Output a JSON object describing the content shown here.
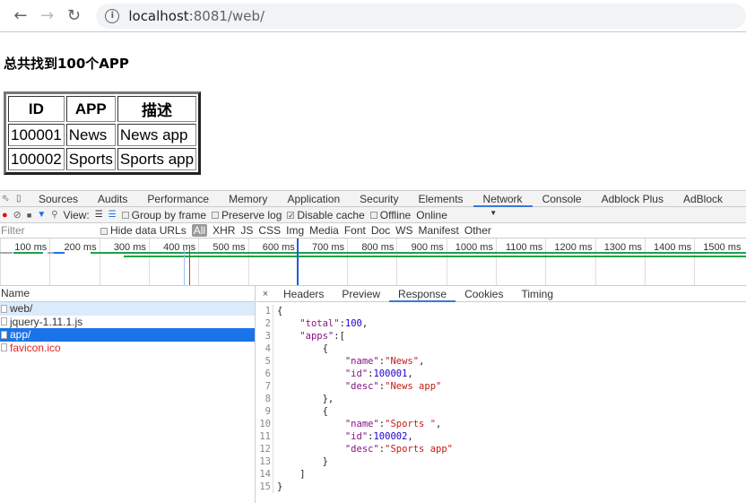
{
  "browser": {
    "url_host": "localhost",
    "url_rest": ":8081/web/"
  },
  "page": {
    "heading": "总共找到100个APP",
    "table": {
      "headers": [
        "ID",
        "APP",
        "描述"
      ],
      "rows": [
        [
          "100001",
          "News",
          "News app"
        ],
        [
          "100002",
          "Sports",
          "Sports app"
        ]
      ]
    }
  },
  "devtools": {
    "tabs": [
      "Sources",
      "Audits",
      "Performance",
      "Memory",
      "Application",
      "Security",
      "Elements",
      "Network",
      "Console",
      "Adblock Plus",
      "AdBlock"
    ],
    "active_tab": "Network",
    "toolbar": {
      "view": "View:",
      "group_by_frame": "Group by frame",
      "preserve_log": "Preserve log",
      "disable_cache": "Disable cache",
      "disable_cache_checked": true,
      "offline": "Offline",
      "throttle": "Online"
    },
    "filter": {
      "placeholder": "Filter",
      "hide_data_urls": "Hide data URLs",
      "types": [
        "All",
        "XHR",
        "JS",
        "CSS",
        "Img",
        "Media",
        "Font",
        "Doc",
        "WS",
        "Manifest",
        "Other"
      ]
    },
    "timeline_ticks": [
      "100 ms",
      "200 ms",
      "300 ms",
      "400 ms",
      "500 ms",
      "600 ms",
      "700 ms",
      "800 ms",
      "900 ms",
      "1000 ms",
      "1100 ms",
      "1200 ms",
      "1300 ms",
      "1400 ms",
      "1500 ms"
    ],
    "requests": {
      "header": "Name",
      "items": [
        {
          "name": "web/",
          "state": "hover"
        },
        {
          "name": "jquery-1.11.1.js",
          "state": ""
        },
        {
          "name": "app/",
          "state": "selected"
        },
        {
          "name": "favicon.ico",
          "state": "error"
        }
      ]
    },
    "detail_tabs": [
      "Headers",
      "Preview",
      "Response",
      "Cookies",
      "Timing"
    ],
    "active_detail_tab": "Response",
    "close": "×",
    "response_lines": [
      [
        [
          "p",
          "{"
        ]
      ],
      [
        [
          "p",
          "    "
        ],
        [
          "k",
          "\"total\""
        ],
        [
          "p",
          ":"
        ],
        [
          "n",
          "100"
        ],
        [
          "p",
          ","
        ]
      ],
      [
        [
          "p",
          "    "
        ],
        [
          "k",
          "\"apps\""
        ],
        [
          "p",
          ":["
        ]
      ],
      [
        [
          "p",
          "        {"
        ]
      ],
      [
        [
          "p",
          "            "
        ],
        [
          "k",
          "\"name\""
        ],
        [
          "p",
          ":"
        ],
        [
          "s",
          "\"News\""
        ],
        [
          "p",
          ","
        ]
      ],
      [
        [
          "p",
          "            "
        ],
        [
          "k",
          "\"id\""
        ],
        [
          "p",
          ":"
        ],
        [
          "n",
          "100001"
        ],
        [
          "p",
          ","
        ]
      ],
      [
        [
          "p",
          "            "
        ],
        [
          "k",
          "\"desc\""
        ],
        [
          "p",
          ":"
        ],
        [
          "s",
          "\"News app\""
        ]
      ],
      [
        [
          "p",
          "        },"
        ]
      ],
      [
        [
          "p",
          "        {"
        ]
      ],
      [
        [
          "p",
          "            "
        ],
        [
          "k",
          "\"name\""
        ],
        [
          "p",
          ":"
        ],
        [
          "s",
          "\"Sports \""
        ],
        [
          "p",
          ","
        ]
      ],
      [
        [
          "p",
          "            "
        ],
        [
          "k",
          "\"id\""
        ],
        [
          "p",
          ":"
        ],
        [
          "n",
          "100002"
        ],
        [
          "p",
          ","
        ]
      ],
      [
        [
          "p",
          "            "
        ],
        [
          "k",
          "\"desc\""
        ],
        [
          "p",
          ":"
        ],
        [
          "s",
          "\"Sports app\""
        ]
      ],
      [
        [
          "p",
          "        }"
        ]
      ],
      [
        [
          "p",
          "    ]"
        ]
      ],
      [
        [
          "p",
          "}"
        ]
      ]
    ]
  }
}
